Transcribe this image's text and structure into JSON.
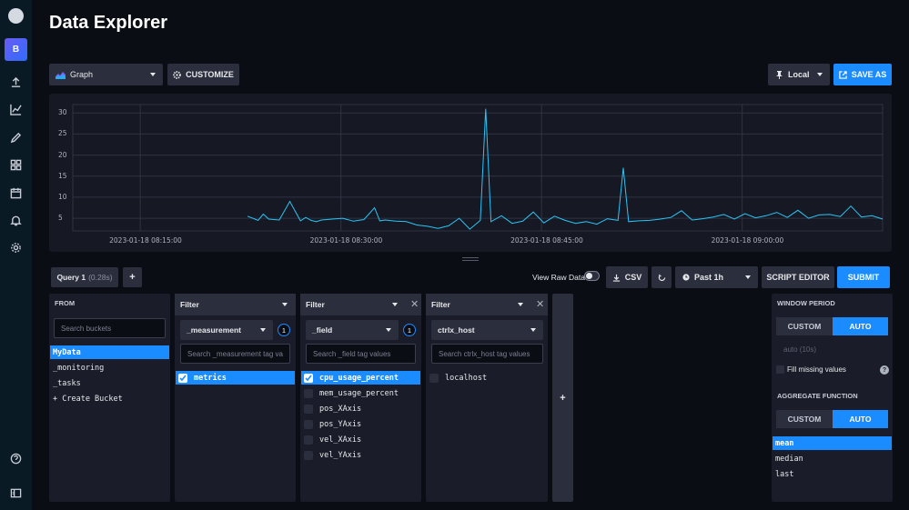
{
  "page": {
    "title": "Data Explorer"
  },
  "sidebar": {
    "org_initial": "B"
  },
  "toolbar": {
    "view_type": "Graph",
    "customize_label": "CUSTOMIZE",
    "timezone": "Local",
    "save_as_label": "SAVE AS"
  },
  "chart_data": {
    "type": "line",
    "y_ticks": [
      "30",
      "25",
      "20",
      "15",
      "10",
      "5"
    ],
    "x_ticks": [
      "2023-01-18 08:15:00",
      "2023-01-18 08:30:00",
      "2023-01-18 08:45:00",
      "2023-01-18 09:00:00"
    ],
    "ylim": [
      2,
      32
    ],
    "grid": true,
    "line_color": "#29c5f6",
    "series": [
      {
        "x_minutes": [
          0,
          1,
          1.5,
          2,
          3,
          4,
          5,
          5.5,
          6,
          6.5,
          7,
          8,
          9,
          10,
          11,
          12,
          12.5,
          13,
          14,
          15,
          16,
          17,
          18,
          19,
          20,
          21,
          22,
          22.5,
          23,
          24,
          25,
          26,
          27,
          28,
          29,
          30,
          31,
          32,
          33,
          34,
          35,
          35.5,
          36,
          37,
          38,
          39,
          40,
          41,
          42,
          43,
          44,
          45,
          46,
          47,
          48,
          49,
          50,
          51,
          52,
          53,
          54,
          55,
          56,
          57,
          58,
          59,
          60
        ],
        "values": [
          5.5,
          4.5,
          6,
          4.8,
          4.6,
          9,
          4.4,
          5.2,
          4.5,
          4.2,
          4.6,
          4.8,
          5,
          4.3,
          4.7,
          7.5,
          4.4,
          4.6,
          4.3,
          4.2,
          3.4,
          3.1,
          2.6,
          3.2,
          5,
          2.4,
          4.5,
          31,
          4.2,
          5.6,
          3.8,
          4.3,
          6.5,
          3.9,
          5.5,
          4.5,
          3.8,
          4.2,
          3.6,
          4.9,
          4.5,
          17,
          4.2,
          4.4,
          4.5,
          4.8,
          5.2,
          6.8,
          4.6,
          4.9,
          5.3,
          5.9,
          4.8,
          6.1,
          5.1,
          5.6,
          6.4,
          5.2,
          6.9,
          5,
          5.8,
          5.9,
          5.4,
          7.9,
          5.3,
          5.6,
          4.8
        ]
      }
    ]
  },
  "query": {
    "tab_label": "Query 1",
    "tab_time": "(0.28s)",
    "add_label": "+"
  },
  "controls": {
    "view_raw_label": "View Raw Data",
    "csv_label": "CSV",
    "time_range": "Past 1h",
    "script_editor_label": "SCRIPT EDITOR",
    "submit_label": "SUBMIT"
  },
  "from_panel": {
    "heading": "FROM",
    "search_placeholder": "Search buckets",
    "buckets": [
      "MyData",
      "_monitoring",
      "_tasks"
    ],
    "create_label": "+ Create Bucket"
  },
  "filters": [
    {
      "header": "Filter",
      "key": "_measurement",
      "count": "1",
      "search_placeholder": "Search _measurement tag va",
      "values": [
        "metrics"
      ],
      "selected": [
        0
      ]
    },
    {
      "header": "Filter",
      "key": "_field",
      "count": "1",
      "search_placeholder": "Search _field tag values",
      "values": [
        "cpu_usage_percent",
        "mem_usage_percent",
        "pos_XAxis",
        "pos_YAxis",
        "vel_XAxis",
        "vel_YAxis"
      ],
      "selected": [
        0
      ]
    },
    {
      "header": "Filter",
      "key": "ctrlx_host",
      "search_placeholder": "Search ctrlx_host tag values",
      "values": [
        "localhost"
      ],
      "selected": []
    }
  ],
  "add_filter_label": "+",
  "aggregate": {
    "window_heading": "WINDOW PERIOD",
    "custom_label": "CUSTOM",
    "auto_label": "AUTO",
    "auto_hint": "auto (10s)",
    "fill_label": "Fill missing values",
    "agg_heading": "AGGREGATE FUNCTION",
    "functions": [
      "mean",
      "median",
      "last"
    ]
  }
}
